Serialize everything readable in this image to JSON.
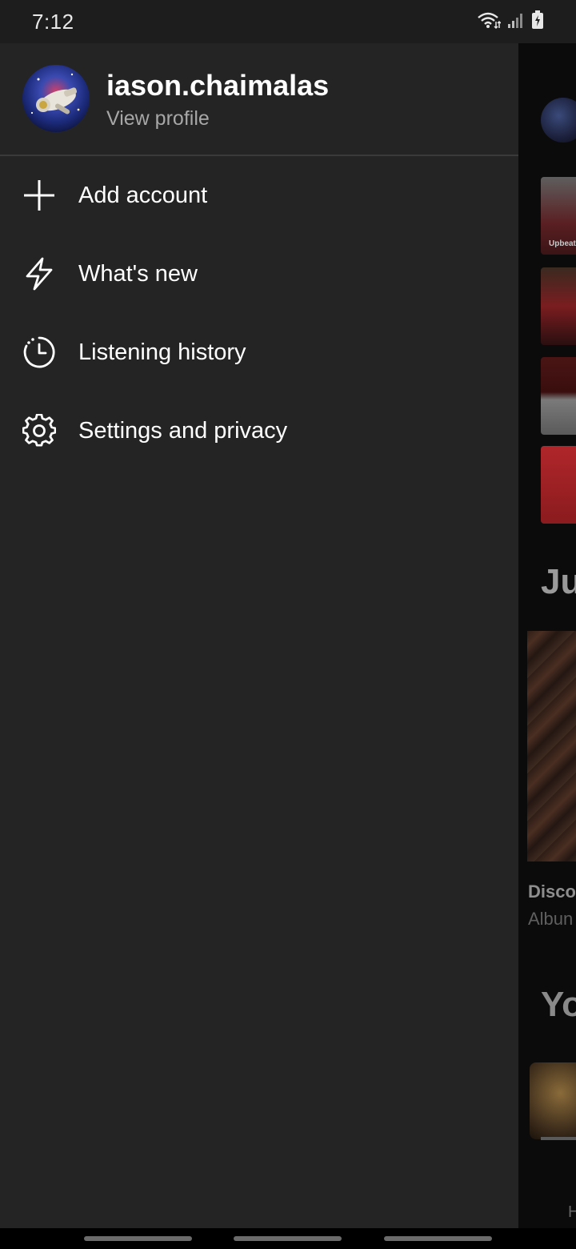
{
  "status_bar": {
    "time": "7:12"
  },
  "drawer": {
    "profile": {
      "username": "iason.chaimalas",
      "view_profile_label": "View profile"
    },
    "menu": [
      {
        "label": "Add account",
        "icon": "plus-icon"
      },
      {
        "label": "What's new",
        "icon": "lightning-icon"
      },
      {
        "label": "Listening history",
        "icon": "history-clock-icon"
      },
      {
        "label": "Settings and privacy",
        "icon": "gear-icon"
      }
    ]
  },
  "background": {
    "card_label": "Upbeat",
    "heading_1": "Ju",
    "album_title": "Disco",
    "album_subtitle": "Albun",
    "heading_2": "Yo",
    "bottom_letter": "H"
  },
  "colors": {
    "drawer_bg": "#242424",
    "status_bar_bg": "#1d1d1d",
    "secondary_text": "#a7a7a7"
  }
}
